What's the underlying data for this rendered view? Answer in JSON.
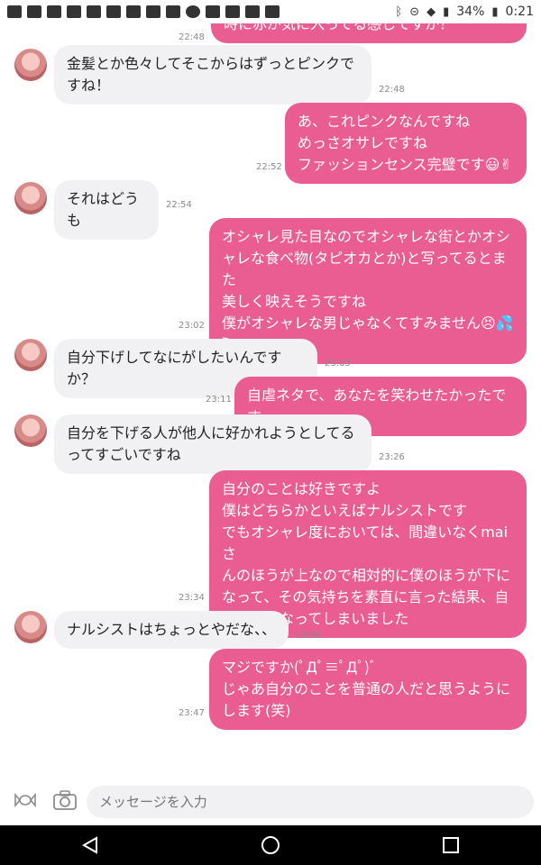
{
  "status_bar": {
    "battery": "34%",
    "time": "0:21"
  },
  "conversation": {
    "messages": [
      {
        "dir": "out",
        "text": "時に赤が気に入ってる感じですか？",
        "time": "22:48"
      },
      {
        "dir": "in",
        "text": "金髪とか色々してそこからはずっとピンクで\nすね！",
        "time": "22:48"
      },
      {
        "dir": "out",
        "text": "あ、これピンクなんですね\nめっさオサレですね\nファッションセンス完璧です😃✌",
        "time": "22:52"
      },
      {
        "dir": "in",
        "text": "それはどうも",
        "time": "22:54"
      },
      {
        "dir": "out",
        "text": "オシャレ見た目なのでオシャレな街とかオシ\nャレな食べ物(タピオカとか)と写ってるとまた\n美しく映えそうですね\n僕がオシャレな男じゃなくてすみません😣💦\n⤵",
        "time": "23:02"
      },
      {
        "dir": "in",
        "text": "自分下げしてなにがしたいんですか？",
        "time": "23:05"
      },
      {
        "dir": "out",
        "text": "自虐ネタで、あなたを笑わせたかったです",
        "time": "23:11"
      },
      {
        "dir": "in",
        "text": "自分を下げる人が他人に好かれようとしてる\nってすごいですね",
        "time": "23:26"
      },
      {
        "dir": "out",
        "text": "自分のことは好きですよ\n僕はどちらかといえばナルシストです\nでもオシャレ度においては、間違いなくmaiさ\nんのほうが上なので相対的に僕のほうが下に\nなって、その気持ちを素直に言った結果、自\n分下げになってしまいました",
        "time": "23:34"
      },
      {
        "dir": "in",
        "text": "ナルシストはちょっとやだな、、",
        "time": "23:39"
      },
      {
        "dir": "out",
        "text": "マジですか(ﾟДﾟ≡ﾟДﾟ)ﾞ\nじゃあ自分のことを普通の人だと思うように\nします(笑)",
        "time": "23:47"
      }
    ]
  },
  "input": {
    "placeholder": "メッセージを入力"
  },
  "colors": {
    "outgoing": "#ea5d92",
    "incoming": "#f1f1f3"
  },
  "icons": [
    "candy-icon",
    "camera-icon",
    "back-icon",
    "home-icon",
    "recents-icon"
  ]
}
